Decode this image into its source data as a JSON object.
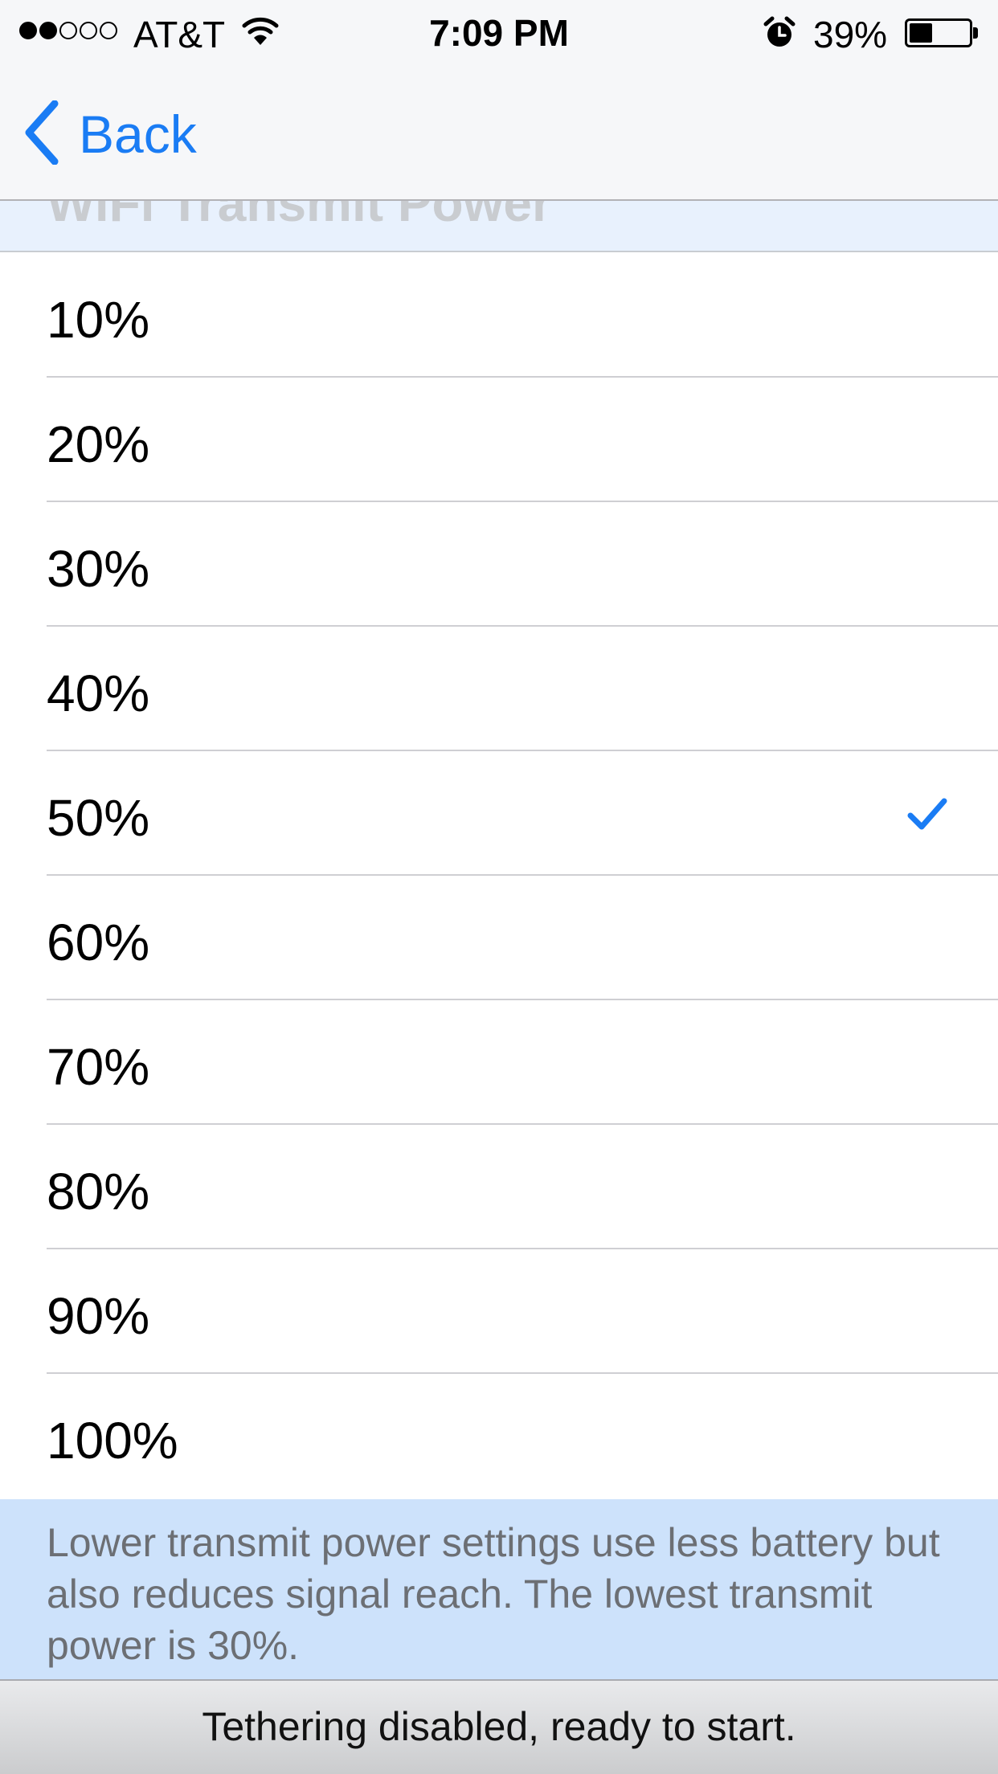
{
  "status_bar": {
    "carrier": "AT&T",
    "time": "7:09 PM",
    "battery_percent": "39%",
    "battery_level": 0.39,
    "signal_bars_filled": 2,
    "signal_bars_total": 5
  },
  "nav": {
    "back_label": "Back",
    "accent_color": "#1a7cf4"
  },
  "section": {
    "header": "WiFi Transmit Power"
  },
  "options": [
    {
      "label": "10%",
      "selected": false
    },
    {
      "label": "20%",
      "selected": false
    },
    {
      "label": "30%",
      "selected": false
    },
    {
      "label": "40%",
      "selected": false
    },
    {
      "label": "50%",
      "selected": true
    },
    {
      "label": "60%",
      "selected": false
    },
    {
      "label": "70%",
      "selected": false
    },
    {
      "label": "80%",
      "selected": false
    },
    {
      "label": "90%",
      "selected": false
    },
    {
      "label": "100%",
      "selected": false
    }
  ],
  "footer": {
    "note": "Lower transmit power settings use less battery but also reduces signal reach. The lowest transmit power is 30%."
  },
  "bottom_status": "Tethering disabled, ready to start."
}
